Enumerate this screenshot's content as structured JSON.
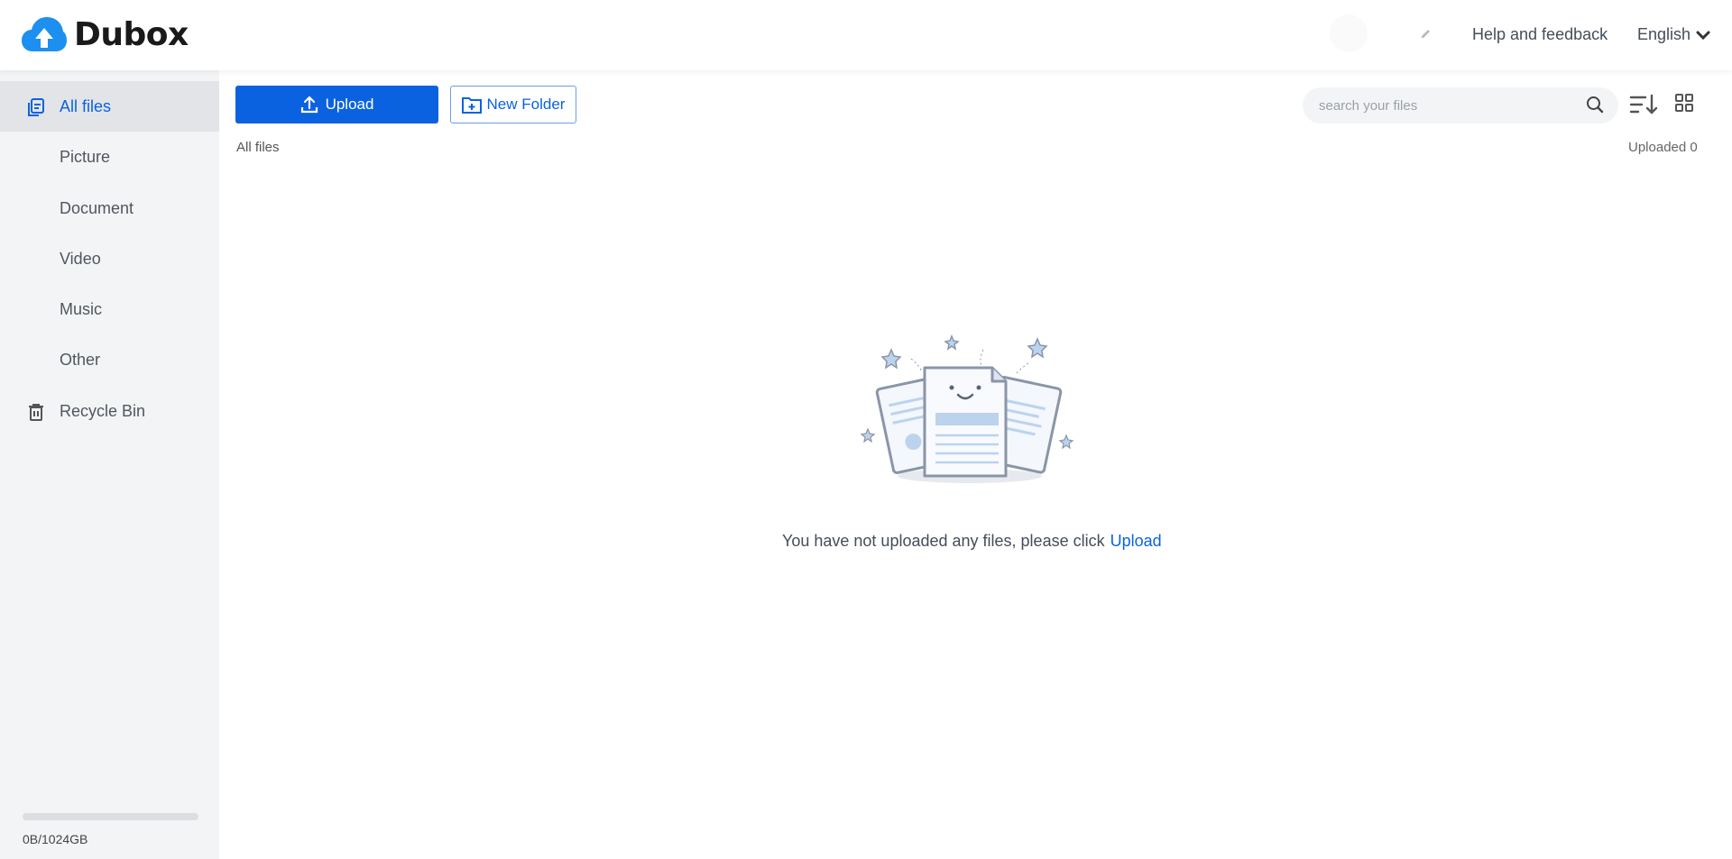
{
  "header": {
    "logo_text": "Dubox",
    "help_label": "Help and feedback",
    "language": "English"
  },
  "sidebar": {
    "items": [
      {
        "label": "All files",
        "icon": "files-icon",
        "active": true
      },
      {
        "label": "Picture"
      },
      {
        "label": "Document"
      },
      {
        "label": "Video"
      },
      {
        "label": "Music"
      },
      {
        "label": "Other"
      },
      {
        "label": "Recycle Bin",
        "icon": "trash-icon"
      }
    ],
    "storage_text": "0B/1024GB",
    "storage_used_fraction": 0
  },
  "toolbar": {
    "upload_label": "Upload",
    "new_folder_label": "New Folder",
    "search_placeholder": "search your files"
  },
  "main": {
    "breadcrumb": "All files",
    "uploaded_count": "Uploaded 0",
    "empty_message": "You have not uploaded any files, please click",
    "empty_link": "Upload"
  },
  "colors": {
    "accent": "#0b62e0",
    "sidebar_bg": "#f3f4f6",
    "active_item_bg": "#e2e4e8"
  }
}
